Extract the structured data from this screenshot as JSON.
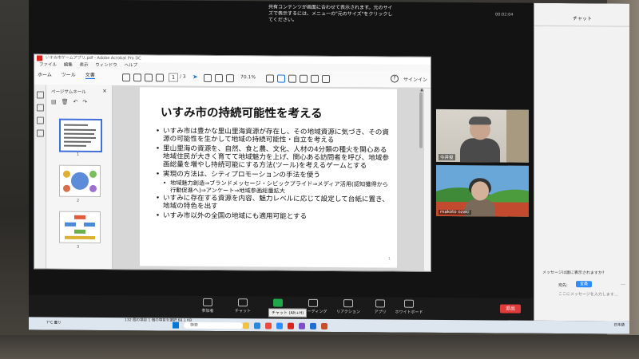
{
  "zoom": {
    "top_notice": "共有コンテンツが画面に合わせて表示されます。元のサイズで表示するには、メニューの\"元のサイズ\"をクリックしてください。",
    "status_time": "00:02:04",
    "chat": {
      "title": "チャット",
      "hint": "メッセージは誰に表示されますか?",
      "to_label": "宛先:",
      "to_value": "全員",
      "placeholder": "ここにメッセージを入力します..."
    },
    "participants": [
      {
        "name": "今井俊"
      },
      {
        "name": "makoto ozaki"
      }
    ],
    "toolbar": {
      "participants": "参加者",
      "chat": "チャット",
      "share": "共有",
      "record": "レコーディング",
      "reactions": "リアクション",
      "apps": "アプリ",
      "whiteboard": "ホワイトボード",
      "end": "退出",
      "tooltip": "チャット (Alt+H)"
    }
  },
  "acrobat": {
    "title": "いすみ市ゲームアプリ.pdf - Adobe Acrobat Pro DC",
    "menu": [
      "ファイル",
      "編集",
      "表示",
      "ウィンドウ",
      "ヘルプ"
    ],
    "tabs": [
      "ホーム",
      "ツール",
      "文書"
    ],
    "page_current": "1",
    "page_total": "/ 3",
    "zoom": "70.1%",
    "signin": "サインイン",
    "thumb_title": "ページサムネール",
    "thumb_numbers": [
      "1",
      "2",
      "3"
    ],
    "slide": {
      "title": "いすみ市の持続可能性を考える",
      "bullets": [
        "いすみ市は豊かな里山里海資源が存在し、その地域資源に気づき、その資源の可能性を生かして地域の持続可能性・自立を考える",
        "里山里海の資源を、自然、食と農、文化、人材の4分類の種火を関心ある地域住民が大きく育てて地域魅力を上げ、関心ある訪問者を呼び、地域参画総量を増やし持続可能にする方法(ツール)を考えるゲームとする",
        "実現の方法は、シティプロモーションの手法を使う"
      ],
      "sub_bullets": [
        "地域魅力創造⇒ブランドメッセージ・シビックプライド⇒メディア活用(認知獲得から行動促進へ)⇒アンケート⇒地域参画総量拡大"
      ],
      "bullets2": [
        "いすみに存在する資源を内容、魅力レベルに応じて設定して台紙に置き、地域の特色を出す",
        "いすみ市以外の全国の地域にも適用可能とする"
      ],
      "page_mark": "1"
    }
  },
  "taskbar": {
    "status_line": "132 個の項目  1 個の項目を選択  68.1 KB",
    "weather": "7°C  曇り",
    "search_placeholder": "検索",
    "ime": "日本語"
  },
  "colors": {
    "accent": "#1473e6",
    "zoom_blue": "#2d8cff",
    "end_red": "#e03a3a",
    "acrobat_red": "#d9241c"
  }
}
